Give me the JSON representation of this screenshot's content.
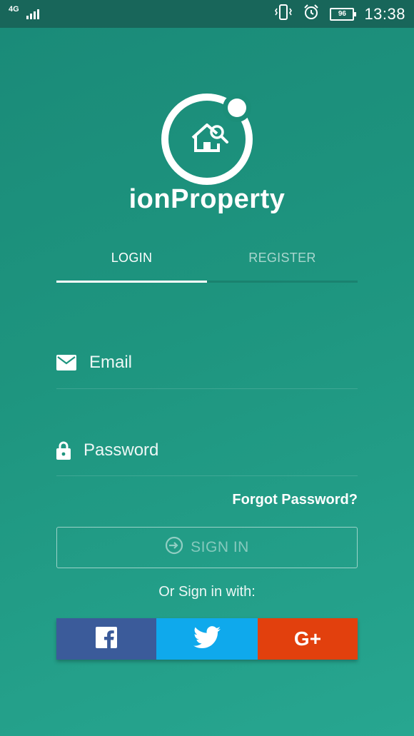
{
  "status_bar": {
    "network": "4G",
    "time": "13:38",
    "battery": "96",
    "icons": [
      "signal-icon",
      "vibrate-icon",
      "alarm-icon",
      "battery-icon"
    ]
  },
  "app": {
    "title": "ionProperty",
    "logo_icon": "house-search-icon"
  },
  "tabs": [
    {
      "label": "LOGIN",
      "active": true
    },
    {
      "label": "REGISTER",
      "active": false
    }
  ],
  "form": {
    "email_placeholder": "Email",
    "email_value": "",
    "password_placeholder": "Password",
    "password_value": "",
    "forgot_label": "Forgot Password?",
    "signin_label": "SIGN IN",
    "or_text": "Or Sign in with:"
  },
  "social": {
    "google_label": "G+"
  },
  "colors": {
    "background": "#1e957f",
    "status_bar": "#18665a",
    "facebook": "#3b5b9a",
    "twitter": "#0fa9ec",
    "google": "#e2400d"
  }
}
